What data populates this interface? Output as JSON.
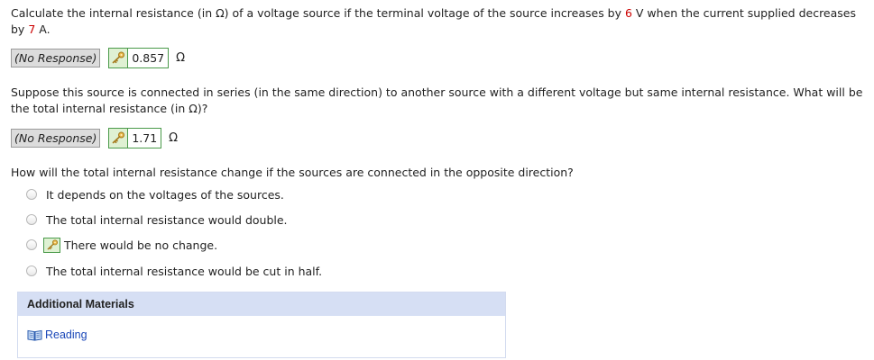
{
  "q1": {
    "text_before": "Calculate the internal resistance (in Ω) of a voltage source if the terminal voltage of the source increases by ",
    "voltage_value": "6",
    "text_mid": " V when the current supplied decreases by ",
    "current_value": "7",
    "text_after": " A.",
    "no_response_label": "(No Response)",
    "answer": "0.857",
    "unit": "Ω"
  },
  "q2": {
    "text": "Suppose this source is connected in series (in the same direction) to another source with a different voltage but same internal resistance. What will be the total internal resistance (in Ω)?",
    "no_response_label": "(No Response)",
    "answer": "1.71",
    "unit": "Ω"
  },
  "q3": {
    "text": "How will the total internal resistance change if the sources are connected in the opposite direction?",
    "options": [
      "It depends on the voltages of the sources.",
      "The total internal resistance would double.",
      "There would be no change.",
      "The total internal resistance would be cut in half."
    ],
    "correct_index": 2
  },
  "additional_materials": {
    "title": "Additional Materials",
    "link_label": "Reading"
  },
  "colors": {
    "highlight": "#cc0000",
    "key_bg": "#dff1d3",
    "key_border": "#4a9a4a",
    "link": "#1a47b8",
    "panel_header": "#d6dff4"
  },
  "icons": {
    "answer_key": "key-icon",
    "reading": "book-icon"
  }
}
